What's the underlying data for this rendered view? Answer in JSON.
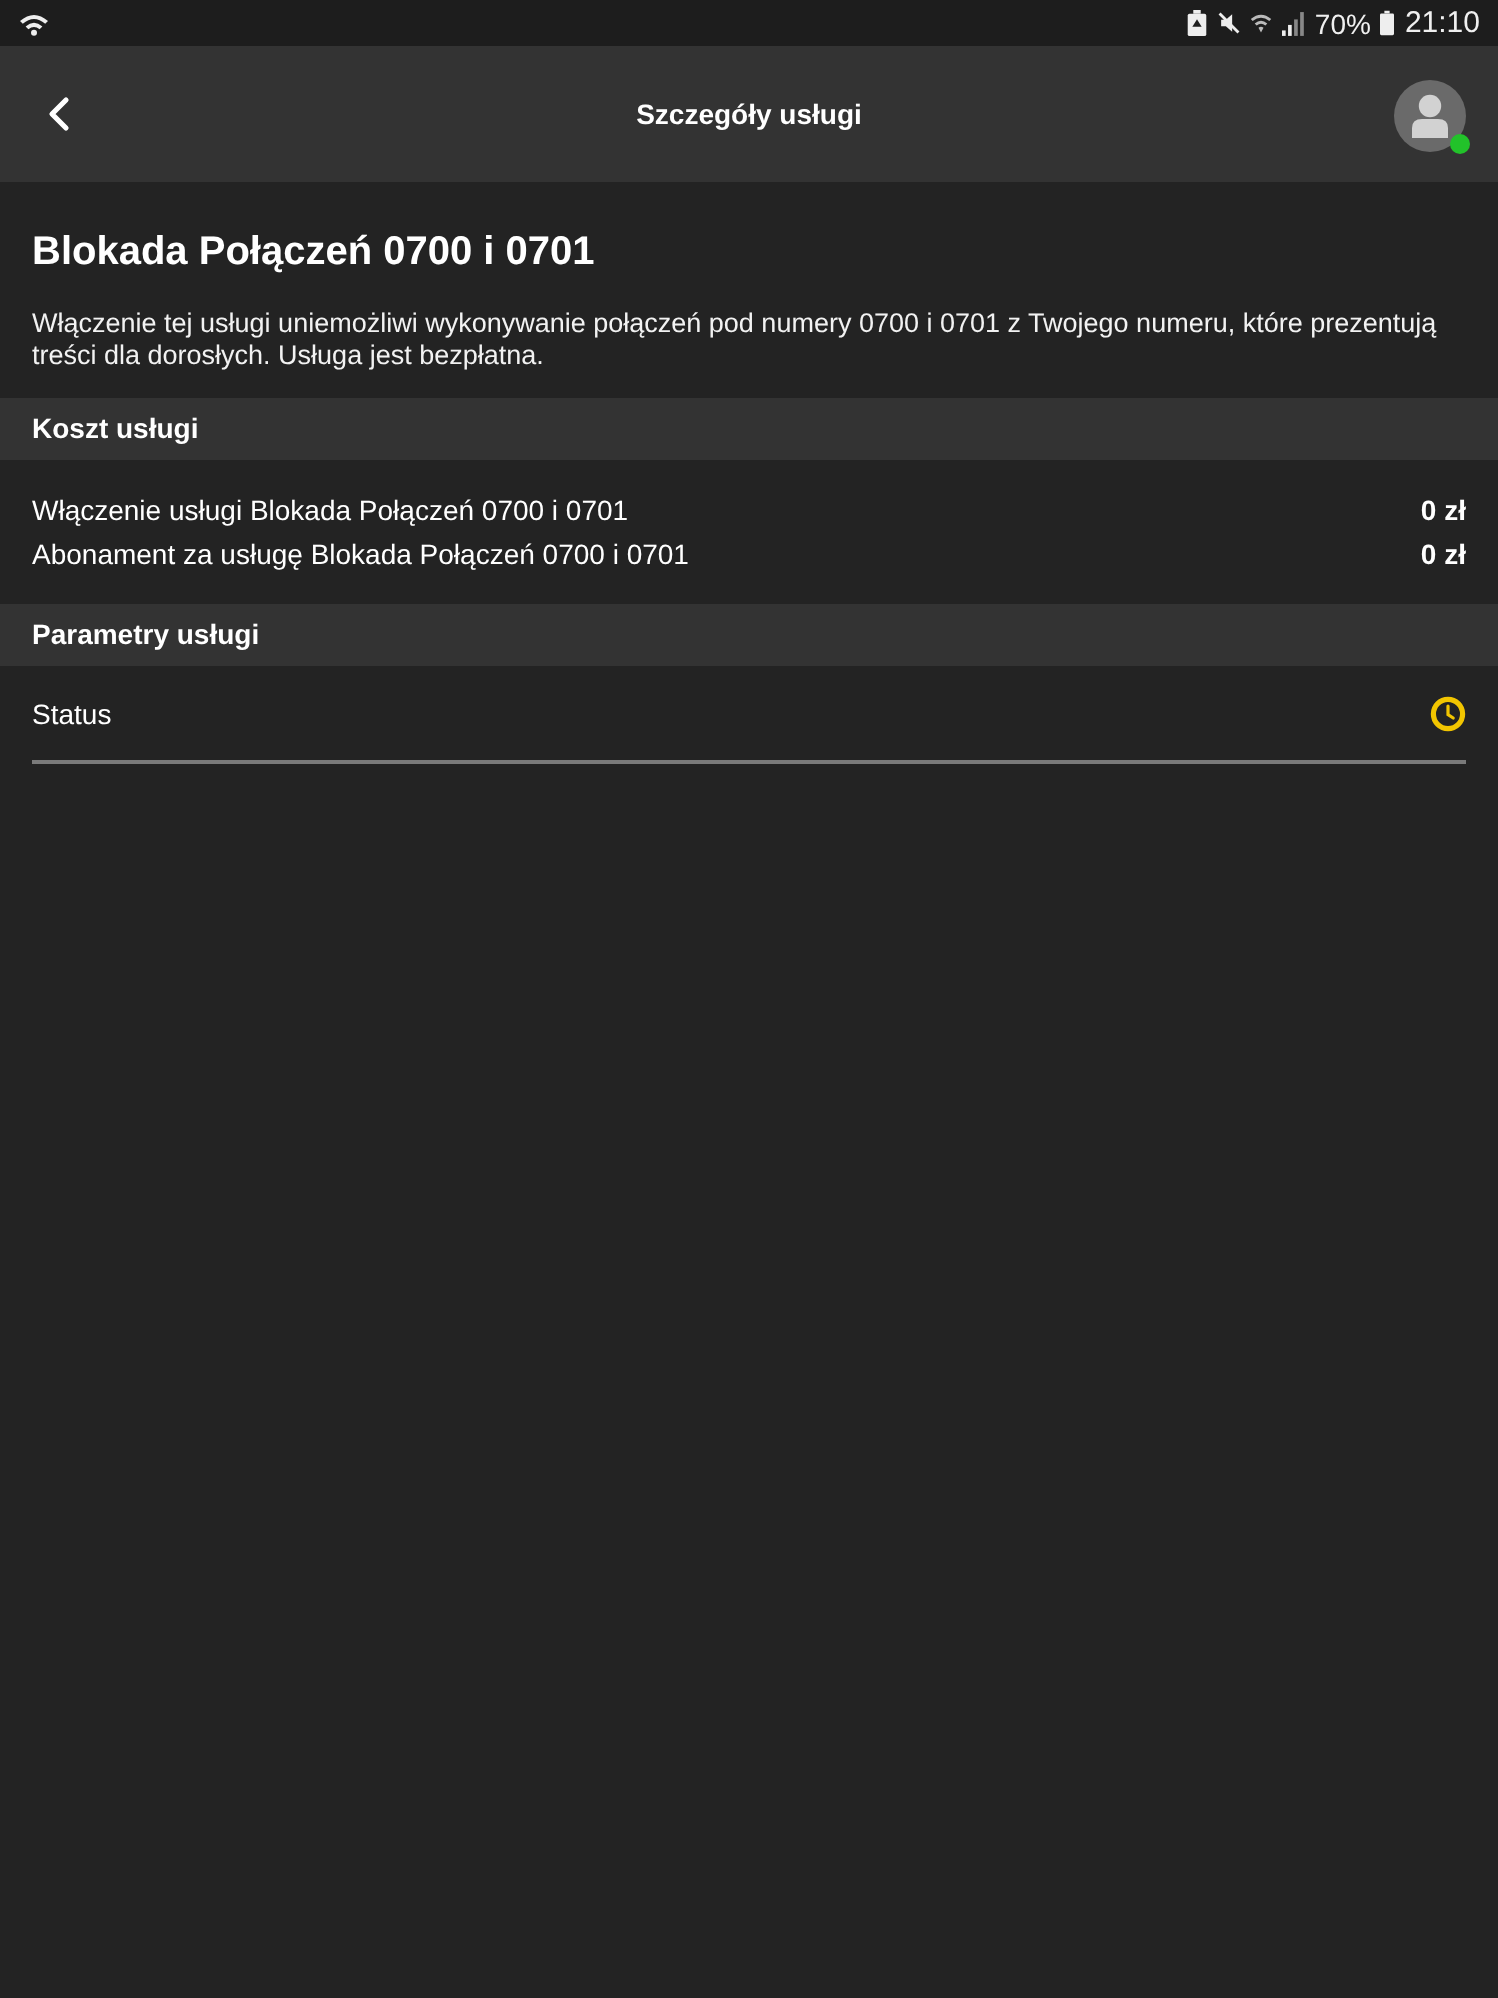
{
  "status_bar": {
    "battery": "70%",
    "time": "21:10"
  },
  "app_bar": {
    "title": "Szczegóły usługi",
    "avatar": {
      "online": true
    }
  },
  "service": {
    "title": "Blokada Połączeń 0700 i 0701",
    "description": "Włączenie tej usługi uniemożliwi wykonywanie połączeń pod numery 0700 i 0701 z Twojego numeru, które prezentują treści dla dorosłych. Usługa jest bezpłatna."
  },
  "sections": [
    {
      "title": "Koszt usługi",
      "rows": [
        {
          "kind": "amount",
          "label": "Włączenie usługi Blokada Połączeń 0700 i 0701",
          "value": "0 zł"
        },
        {
          "kind": "amount",
          "label": "Abonament za usługę Blokada Połączeń 0700 i 0701",
          "value": "0 zł"
        }
      ]
    },
    {
      "title": "Parametry usługi",
      "rows": [
        {
          "kind": "status",
          "label": "Status"
        }
      ]
    }
  ]
}
